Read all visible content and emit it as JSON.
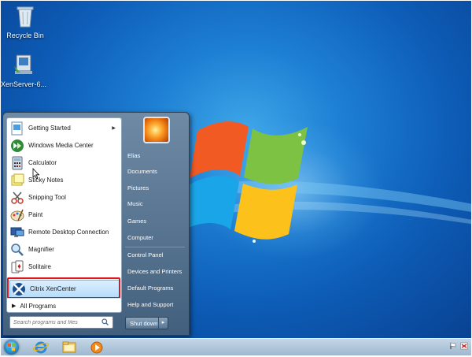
{
  "desktop": {
    "icons": [
      {
        "label": "Recycle Bin"
      },
      {
        "label": "XenServer-6..."
      }
    ]
  },
  "start_menu": {
    "programs": [
      {
        "label": "Getting Started",
        "icon": "getting-started-icon",
        "has_submenu": true
      },
      {
        "label": "Windows Media Center",
        "icon": "media-center-icon"
      },
      {
        "label": "Calculator",
        "icon": "calculator-icon"
      },
      {
        "label": "Sticky Notes",
        "icon": "sticky-notes-icon"
      },
      {
        "label": "Snipping Tool",
        "icon": "snipping-tool-icon"
      },
      {
        "label": "Paint",
        "icon": "paint-icon"
      },
      {
        "label": "Remote Desktop Connection",
        "icon": "remote-desktop-icon"
      },
      {
        "label": "Magnifier",
        "icon": "magnifier-icon"
      },
      {
        "label": "Solitaire",
        "icon": "solitaire-icon"
      },
      {
        "label": "Citrix XenCenter",
        "icon": "xencenter-icon",
        "selected": true
      }
    ],
    "all_programs_label": "All Programs",
    "search_placeholder": "Search programs and files",
    "right_items": [
      "Elias",
      "Documents",
      "Pictures",
      "Music",
      "Games",
      "Computer",
      "Control Panel",
      "Devices and Printers",
      "Default Programs",
      "Help and Support"
    ],
    "shutdown_label": "Shut down"
  },
  "taskbar": {
    "pinned": [
      "internet-explorer-icon",
      "windows-explorer-icon",
      "media-player-icon"
    ]
  }
}
